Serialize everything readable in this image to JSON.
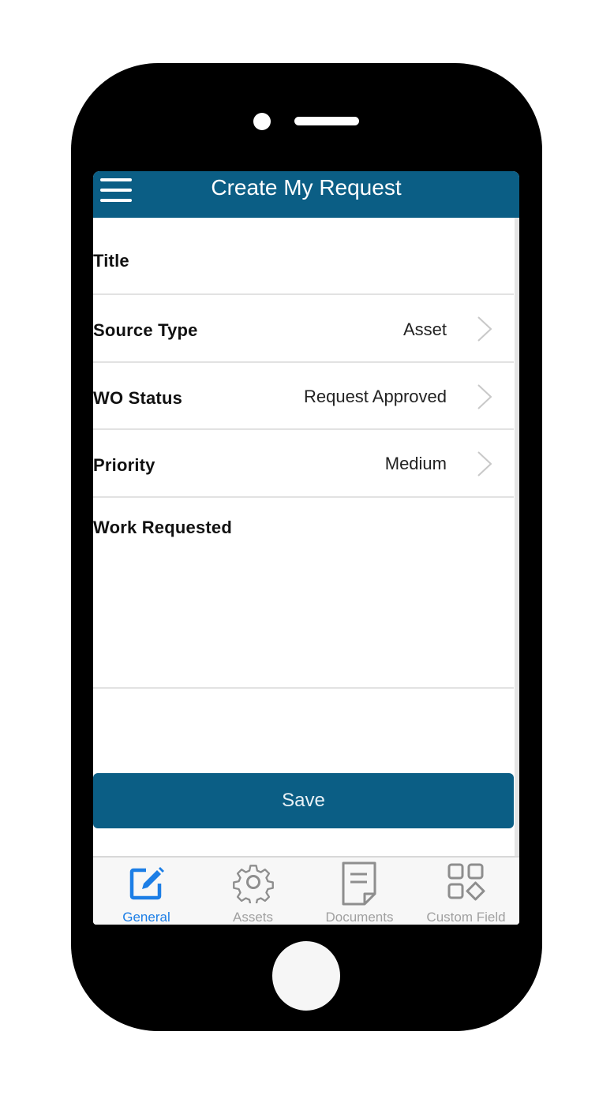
{
  "navbar": {
    "title": "Create My Request",
    "menu_icon": "hamburger-menu-icon",
    "color": "#0b5e85"
  },
  "form": {
    "fields": [
      {
        "label": "Title",
        "value": ""
      },
      {
        "label": "Source Type",
        "value": "Asset"
      },
      {
        "label": "WO Status",
        "value": "Request Approved"
      },
      {
        "label": "Priority",
        "value": "Medium"
      },
      {
        "label": "Work Requested",
        "value": ""
      }
    ],
    "chevron_icon": "chevron-right-icon"
  },
  "save_button": {
    "label": "Save",
    "color": "#0b5e85"
  },
  "tabs": [
    {
      "label": "General",
      "icon": "edit-icon",
      "active": true,
      "color": "#1c7ee6"
    },
    {
      "label": "Assets",
      "icon": "gear-icon",
      "active": false
    },
    {
      "label": "Documents",
      "icon": "document-icon",
      "active": false
    },
    {
      "label": "Custom Field",
      "icon": "grid-shapes-icon",
      "active": false
    }
  ]
}
